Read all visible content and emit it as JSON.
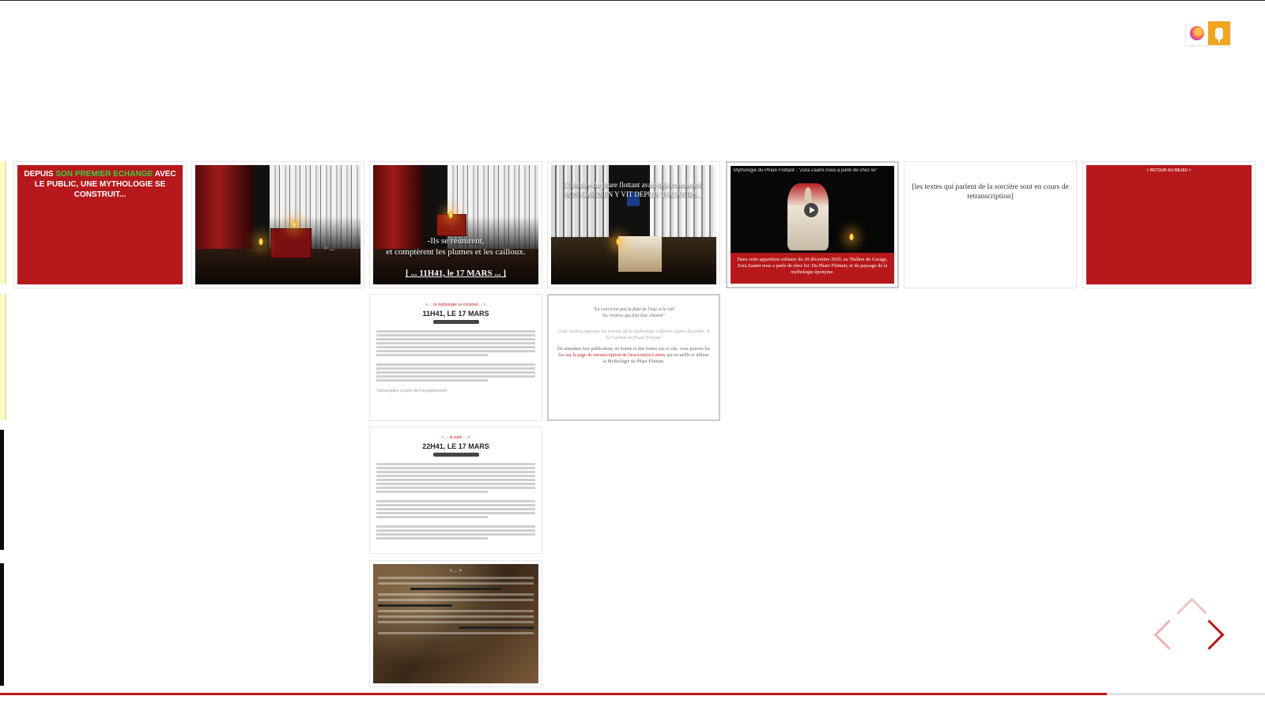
{
  "extension": {
    "firefox_icon": "firefox-icon",
    "mic_icon": "microphone-icon"
  },
  "tiles": {
    "intro": {
      "lead": "DEPUIS",
      "highlight": "SON PREMIER ECHANGE",
      "rest": "AVEC LE PUBLIC, UNE MYTHOLOGIE SE CONSTRUIT..."
    },
    "stage_caption": "> ...",
    "reunion": {
      "line1": "-Ils se réunirent,",
      "line2": "et comptèrent les plumes et les cailloux.",
      "link": "[ ... 11H41, le 17 MARS ... ]"
    },
    "phare": {
      "line1": "L'histoire du phare flottant avait déjà commencé.",
      "line2": "SON GARDIEN Y VIT DEPUIS TOUJOURS..."
    },
    "video": {
      "title": "Mythologie du Phare Flottant : \"Zora Zaami nous a parlé de chez lui\"",
      "caption": "Dans cette apparition solitaire du 20 décembre 2020, au Théâtre du Garage, Zora Zaami nous a parlé de chez lui: Du Phare Flottant, et du paysage de la mythologie éponyme."
    },
    "sorciere": "[les textes qui parlent de la sorcière sont en cours de retranscription]",
    "retour": "> RETOUR AU MILIEU <",
    "doc1": {
      "kicker": "< ... la mythologie se construit ... >",
      "title": "11H41, LE 17 MARS",
      "footer": "Transcription à partir de l'enregistrement"
    },
    "quote": {
      "line1": "\"Le vent n'est pas la fuite de l'eau et le ciel",
      "line2": "les rivières qui font leur chemin\"",
      "p1": "Cette section regroupe les extraits de la mythologie collectés auprès du public et du Gardien du Phare Flottant.",
      "p2a": "En attendant leur publication, en bonne et due forme sur ce site, vous pouvez les lire",
      "link": "sur la page de retranscription de l'association Lettres",
      "p2b": "qui recueille et diffuse la Mythologie du Phare Flottant."
    },
    "doc2": {
      "kicker": "< ... la suite ... >",
      "title": "22H41, LE 17 MARS"
    },
    "texture_label": "< ... >"
  },
  "nav": {
    "up": "chevron-up-icon",
    "left": "chevron-left-icon",
    "right": "chevron-right-icon"
  }
}
